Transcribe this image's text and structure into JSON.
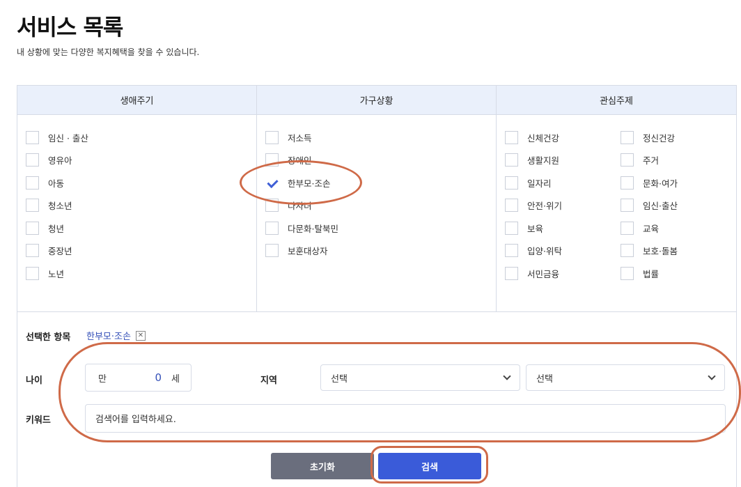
{
  "page": {
    "title": "서비스 목록",
    "subtitle": "내 상황에 맞는 다양한 복지혜택을 찾을 수 있습니다."
  },
  "filters": {
    "columns": [
      {
        "header": "생애주기"
      },
      {
        "header": "가구상황"
      },
      {
        "header": "관심주제"
      }
    ],
    "lifecycle": [
      {
        "label": "임신 · 출산",
        "checked": false
      },
      {
        "label": "영유아",
        "checked": false
      },
      {
        "label": "아동",
        "checked": false
      },
      {
        "label": "청소년",
        "checked": false
      },
      {
        "label": "청년",
        "checked": false
      },
      {
        "label": "중장년",
        "checked": false
      },
      {
        "label": "노년",
        "checked": false
      }
    ],
    "household": [
      {
        "label": "저소득",
        "checked": false
      },
      {
        "label": "장애인",
        "checked": false
      },
      {
        "label": "한부모·조손",
        "checked": true
      },
      {
        "label": "다자녀",
        "checked": false
      },
      {
        "label": "다문화·탈북민",
        "checked": false
      },
      {
        "label": "보훈대상자",
        "checked": false
      }
    ],
    "topics_left": [
      {
        "label": "신체건강",
        "checked": false
      },
      {
        "label": "생활지원",
        "checked": false
      },
      {
        "label": "일자리",
        "checked": false
      },
      {
        "label": "안전·위기",
        "checked": false
      },
      {
        "label": "보육",
        "checked": false
      },
      {
        "label": "입양·위탁",
        "checked": false
      },
      {
        "label": "서민금융",
        "checked": false
      }
    ],
    "topics_right": [
      {
        "label": "정신건강",
        "checked": false
      },
      {
        "label": "주거",
        "checked": false
      },
      {
        "label": "문화·여가",
        "checked": false
      },
      {
        "label": "임신·출산",
        "checked": false
      },
      {
        "label": "교육",
        "checked": false
      },
      {
        "label": "보호·돌봄",
        "checked": false
      },
      {
        "label": "법률",
        "checked": false
      }
    ]
  },
  "selected": {
    "label": "선택한 항목",
    "chip": "한부모·조손",
    "remove_icon": "close-icon"
  },
  "age": {
    "label": "나이",
    "prefix": "만",
    "value": "0",
    "suffix": "세"
  },
  "region": {
    "label": "지역",
    "select1": "선택",
    "select2": "선택"
  },
  "keyword": {
    "label": "키워드",
    "placeholder": "검색어를 입력하세요."
  },
  "buttons": {
    "reset": "초기화",
    "search": "검색"
  },
  "colors": {
    "accent": "#3a5bd9",
    "header_bg": "#eaf0fb",
    "annotation": "#cf6a48",
    "reset_bg": "#6a6e7d"
  }
}
